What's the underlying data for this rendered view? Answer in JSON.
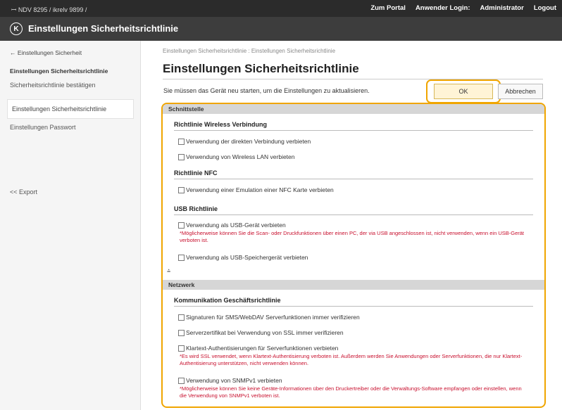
{
  "topbar": {
    "device_name": "ꟷ NDV 8295 / ikrelv 9899 /",
    "links": {
      "portal": "Zum Portal",
      "login": "Anwender Login:",
      "user": "Administrator",
      "logout": "Logout"
    }
  },
  "app": {
    "logo_glyph": "K",
    "title": "Einstellungen Sicherheitsrichtlinie"
  },
  "sidebar": {
    "back": "← Einstellungen Sicherheit",
    "heading": "Einstellungen Sicherheitsrichtlinie",
    "items": [
      {
        "label": "Sicherheitsrichtlinie bestätigen"
      },
      {
        "label": "Einstellungen Sicherheitsrichtlinie"
      },
      {
        "label": "Einstellungen Passwort"
      }
    ],
    "export": "<< Export"
  },
  "main": {
    "breadcrumb": "Einstellungen Sicherheitsrichtlinie : Einstellungen Sicherheitsrichtlinie",
    "title": "Einstellungen Sicherheitsrichtlinie",
    "notice": "Sie müssen das Gerät neu starten, um die Einstellungen zu aktualisieren.",
    "ok": "OK",
    "cancel": "Abbrechen"
  },
  "sections": {
    "interface": {
      "header": "Schnittstelle",
      "wireless": {
        "title": "Richtlinie Wireless Verbindung",
        "opt1": "Verwendung der direkten Verbindung verbieten",
        "opt2": "Verwendung von Wireless LAN verbieten"
      },
      "nfc": {
        "title": "Richtlinie NFC",
        "opt1": "Verwendung einer Emulation einer NFC Karte verbieten"
      },
      "usb": {
        "title": "USB Richtlinie",
        "opt1": "Verwendung als USB-Gerät verbieten",
        "note1": "*Möglicherweise können Sie die Scan- oder Druckfunktionen über einen PC, der via USB angeschlossen ist, nicht verwenden, wenn ein USB-Gerät verboten ist.",
        "opt2": "Verwendung als USB-Speichergerät verbieten"
      },
      "collapse_glyph": "⩮"
    },
    "network": {
      "header": "Netzwerk",
      "comm": {
        "title": "Kommunikation Geschäftsrichtlinie",
        "opt1": "Signaturen für SMS/WebDAV Serverfunktionen immer verifizieren",
        "opt2": "Serverzertifikat bei Verwendung von SSL immer verifizieren",
        "opt3": "Klartext-Authentisierungen für Serverfunktionen verbieten",
        "note3": "*Es wird SSL verwendet, wenn Klartext-Authentisierung verboten ist. Außerdem werden Sie Anwendungen oder Serverfunktionen, die nur Klartext-Authentisierung unterstützen, nicht verwenden können.",
        "opt4": "Verwendung von SNMPv1 verbieten",
        "note4": "*Möglicherweise können Sie keine Geräte-Informationen über den Druckertreiber oder die Verwaltungs-Software empfangen oder einstellen, wenn die Verwendung von SNMPv1 verboten ist."
      }
    }
  },
  "colors": {
    "highlight": "#f0a500",
    "topbar": "#2b2b2b",
    "titlebar": "#3d3d3d",
    "note": "#c8102e"
  }
}
